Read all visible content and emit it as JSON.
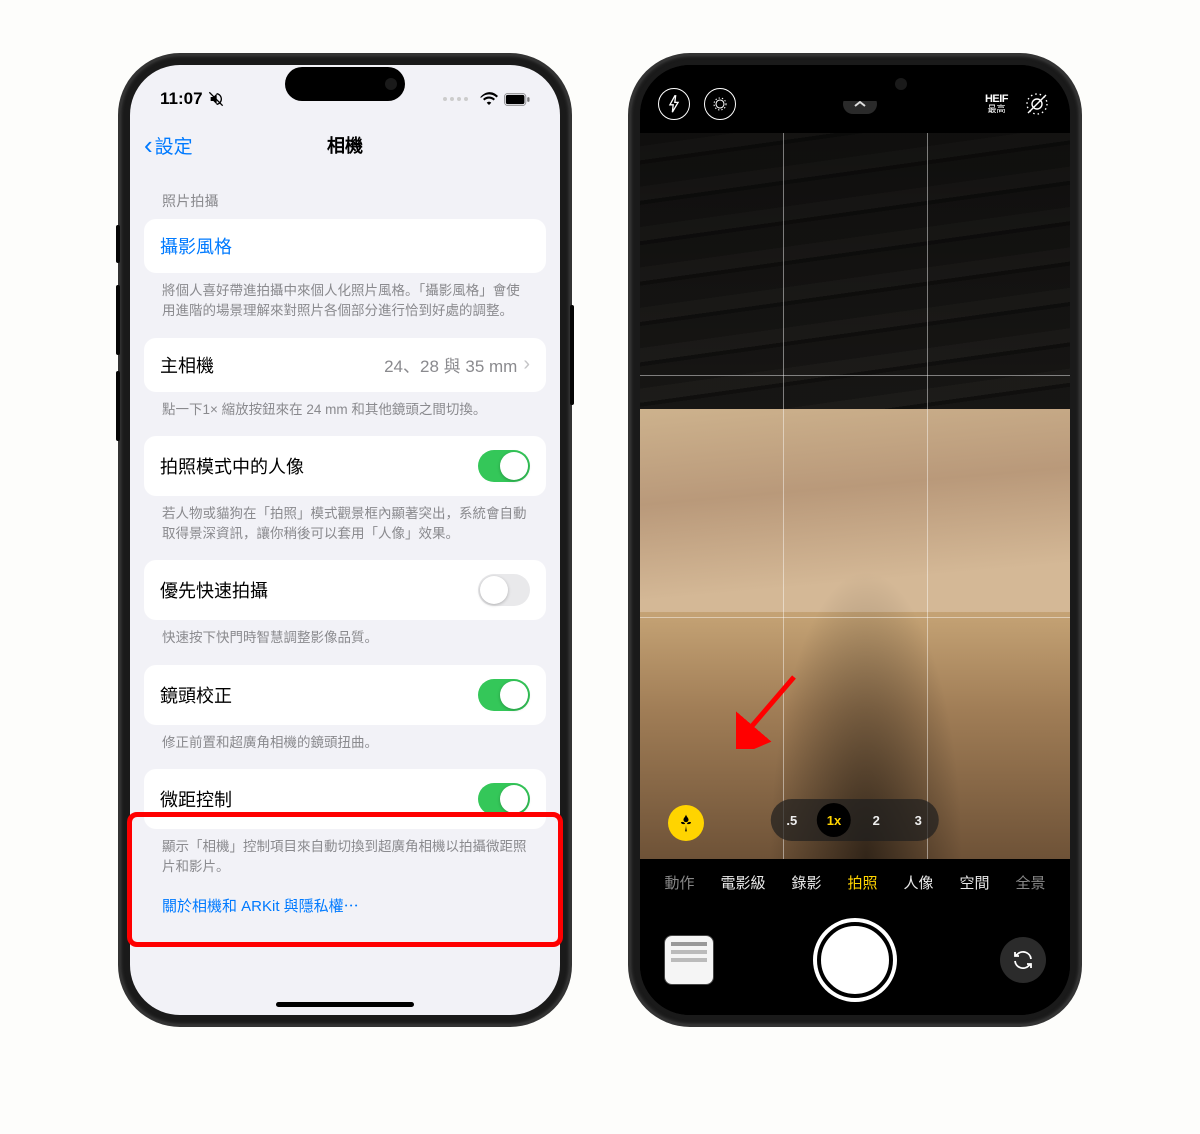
{
  "colors": {
    "accent_blue": "#007aff",
    "toggle_green": "#34c759",
    "highlight_red": "#ff0000",
    "camera_yellow": "#ffd400"
  },
  "settings": {
    "status": {
      "time": "11:07",
      "silent": true
    },
    "nav": {
      "back_label": "設定",
      "title": "相機"
    },
    "sections": {
      "photo_capture_header": "照片拍攝",
      "photographic_styles": {
        "label": "攝影風格",
        "footer": "將個人喜好帶進拍攝中來個人化照片風格。「攝影風格」會使用進階的場景理解來對照片各個部分進行恰到好處的調整。"
      },
      "main_camera": {
        "label": "主相機",
        "value": "24、28 與 35 mm",
        "footer": "點一下1× 縮放按鈕來在 24 mm 和其他鏡頭之間切換。"
      },
      "portrait_in_photo": {
        "label": "拍照模式中的人像",
        "on": true,
        "footer": "若人物或貓狗在「拍照」模式觀景框內顯著突出，系統會自動取得景深資訊，讓你稍後可以套用「人像」效果。"
      },
      "prioritize_faster": {
        "label": "優先快速拍攝",
        "on": false,
        "footer": "快速按下快門時智慧調整影像品質。"
      },
      "lens_correction": {
        "label": "鏡頭校正",
        "on": true,
        "footer": "修正前置和超廣角相機的鏡頭扭曲。"
      },
      "macro_control": {
        "label": "微距控制",
        "on": true,
        "footer": "顯示「相機」控制項目來自動切換到超廣角相機以拍攝微距照片和影片。"
      },
      "privacy_link": "關於相機和 ARKit 與隱私權⋯"
    }
  },
  "camera": {
    "topbar": {
      "flash_icon": "flash-icon",
      "night_icon": "night-mode-icon",
      "expand_icon": "chevron-up-icon",
      "format_badge_top": "HEIF",
      "format_badge_bottom": "最高",
      "live_off_icon": "live-photo-off-icon"
    },
    "macro_icon": "macro-flower-icon",
    "zoom": {
      "levels": [
        ".5",
        "1x",
        "2",
        "3"
      ],
      "active_index": 1
    },
    "modes": [
      "動作",
      "電影級",
      "錄影",
      "拍照",
      "人像",
      "空間",
      "全景"
    ],
    "active_mode_index": 3,
    "shutter": "shutter-button",
    "thumbnail": "last-photo-thumbnail",
    "flip": "flip-camera-icon"
  }
}
